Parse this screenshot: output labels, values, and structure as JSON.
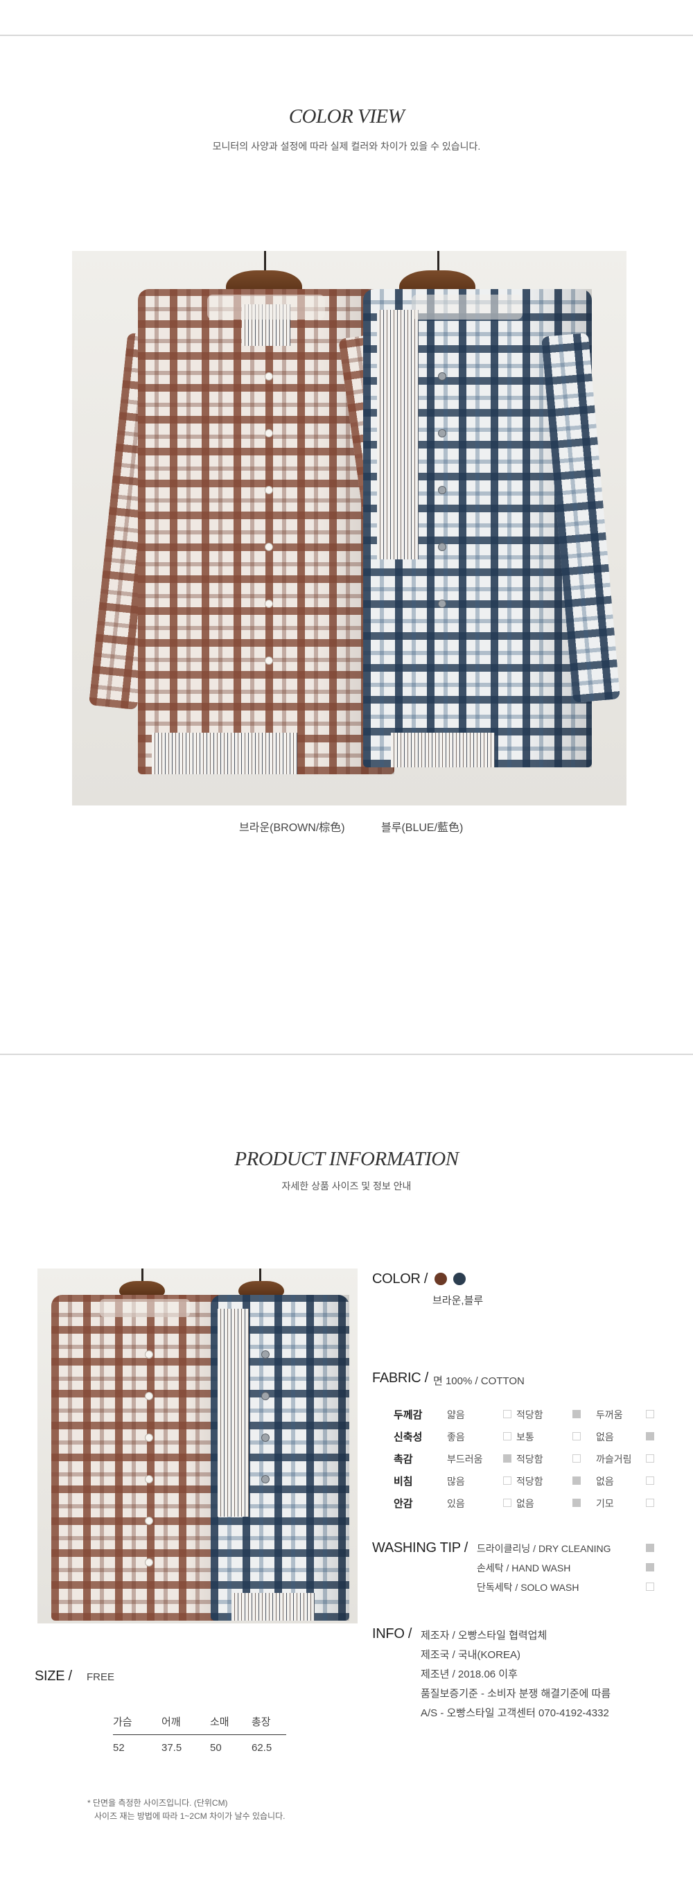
{
  "color_view": {
    "title": "COLOR VIEW",
    "subtitle": "모니터의 사양과 설정에 따라 실제 컬러와 차이가 있을 수 있습니다.",
    "captions": [
      "브라운(BROWN/棕色)",
      "블루(BLUE/藍色)"
    ]
  },
  "product_info": {
    "title": "PRODUCT INFORMATION",
    "subtitle": "자세한 상품 사이즈 및 정보 안내"
  },
  "color": {
    "label": "COLOR /",
    "swatches": [
      "#6b3a26",
      "#2c3e50"
    ],
    "names": "브라운,블루"
  },
  "fabric": {
    "label": "FABRIC /",
    "value": "면 100% / COTTON",
    "rows": [
      {
        "label": "두께감",
        "options": [
          "얇음",
          "적당함",
          "두꺼움"
        ],
        "selected": 1
      },
      {
        "label": "신축성",
        "options": [
          "좋음",
          "보통",
          "없음"
        ],
        "selected": 2
      },
      {
        "label": "촉감",
        "options": [
          "부드러움",
          "적당함",
          "까슬거림"
        ],
        "selected": 0
      },
      {
        "label": "비침",
        "options": [
          "많음",
          "적당함",
          "없음"
        ],
        "selected": 1
      },
      {
        "label": "안감",
        "options": [
          "있음",
          "없음",
          "기모"
        ],
        "selected": 1
      }
    ]
  },
  "washing": {
    "label": "WASHING TIP /",
    "options": [
      {
        "text": "드라이클리닝 / DRY CLEANING",
        "checked": true
      },
      {
        "text": "손세탁 / HAND WASH",
        "checked": true
      },
      {
        "text": "단독세탁 / SOLO WASH",
        "checked": false
      }
    ]
  },
  "info": {
    "label": "INFO /",
    "lines": [
      "제조자 / 오빵스타일 협력업체",
      "제조국 / 국내(KOREA)",
      "제조년 / 2018.06 이후",
      "품질보증기준 - 소비자 분쟁 해결기준에 따름",
      "A/S  - 오빵스타일 고객센터 070-4192-4332"
    ]
  },
  "size": {
    "label": "SIZE /",
    "value": "FREE",
    "headers": [
      "가슴",
      "어깨",
      "소매",
      "총장"
    ],
    "values": [
      "52",
      "37.5",
      "50",
      "62.5"
    ],
    "notes": [
      "* 단면을 측정한 사이즈입니다. (단위CM)",
      "사이즈 재는 방법에 따라 1~2CM 차이가 날수 있습니다."
    ]
  }
}
